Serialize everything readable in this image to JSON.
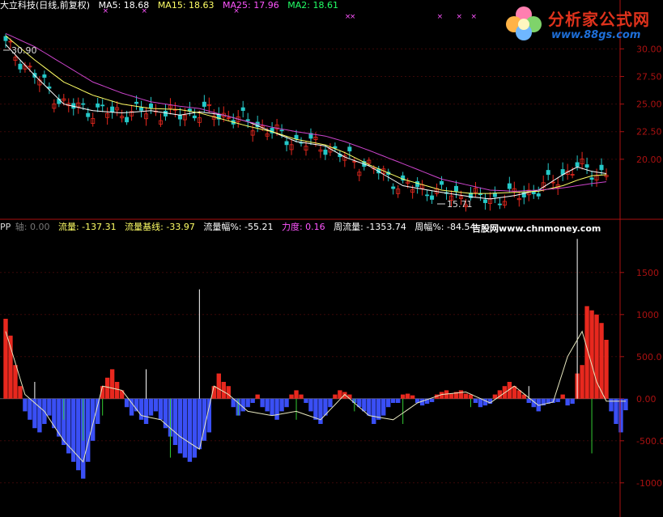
{
  "header_top": {
    "stock": "大立科技(日线,前复权)",
    "ma5": "MA5: 18.68",
    "ma15": "MA15: 18.63",
    "ma25": "MA25: 17.96",
    "ma2": "MA2: 18.61"
  },
  "header_bottom": {
    "name": "PP",
    "axis": "轴: 0.00",
    "flow": "流量: -137.31",
    "flow_base": "流量基线: -33.97",
    "flow_pct": "流量幅%: -55.21",
    "force": "力度: 0.16",
    "week_flow": "周流量: -1353.74",
    "week_pct": "周幅%: -84.54"
  },
  "watermark_bottom": "吉股网www.chnmoney.com",
  "logo": {
    "title": "分析家公式网",
    "url": "www.88gs.com"
  },
  "price_markers": {
    "high": "30.90",
    "low": "15.71"
  },
  "colors": {
    "up": "#e8281e",
    "down": "#3a4ff5",
    "ma5": "#ffffff",
    "ma15": "#ffff66",
    "ma25": "#cc44cc",
    "axis": "#aa1111",
    "teal": "#25c8c8"
  },
  "chart_data": [
    {
      "type": "line",
      "title": "大立科技(日线,前复权)",
      "ylim": [
        15,
        31.5
      ],
      "yticks": [
        "30.00",
        "27.50",
        "25.00",
        "22.50",
        "20.00"
      ],
      "yticks_num": [
        30,
        27.5,
        25,
        22.5,
        20
      ],
      "n": 125,
      "series": [
        {
          "name": "MA5",
          "keys": [
            [
              0,
              30.4
            ],
            [
              6,
              27.6
            ],
            [
              12,
              25.0
            ],
            [
              18,
              24.4
            ],
            [
              24,
              24.2
            ],
            [
              30,
              24.4
            ],
            [
              36,
              24.0
            ],
            [
              40,
              24.3
            ],
            [
              45,
              24.0
            ],
            [
              50,
              23.4
            ],
            [
              55,
              22.5
            ],
            [
              60,
              21.6
            ],
            [
              66,
              21.2
            ],
            [
              70,
              20.2
            ],
            [
              75,
              19.4
            ],
            [
              82,
              17.6
            ],
            [
              90,
              17.0
            ],
            [
              96,
              16.6
            ],
            [
              100,
              16.4
            ],
            [
              105,
              16.7
            ],
            [
              110,
              17.2
            ],
            [
              115,
              18.6
            ],
            [
              118,
              19.3
            ],
            [
              121,
              18.9
            ],
            [
              124,
              18.7
            ]
          ]
        },
        {
          "name": "MA15",
          "keys": [
            [
              0,
              31.2
            ],
            [
              6,
              29.0
            ],
            [
              12,
              27.0
            ],
            [
              18,
              25.8
            ],
            [
              24,
              25.0
            ],
            [
              30,
              24.6
            ],
            [
              36,
              24.5
            ],
            [
              40,
              24.2
            ],
            [
              45,
              23.6
            ],
            [
              50,
              23.0
            ],
            [
              55,
              22.5
            ],
            [
              60,
              21.8
            ],
            [
              66,
              21.3
            ],
            [
              70,
              20.6
            ],
            [
              75,
              19.5
            ],
            [
              82,
              18.2
            ],
            [
              90,
              17.2
            ],
            [
              96,
              16.9
            ],
            [
              100,
              16.9
            ],
            [
              105,
              17.0
            ],
            [
              110,
              17.1
            ],
            [
              115,
              17.6
            ],
            [
              118,
              18.1
            ],
            [
              121,
              18.5
            ],
            [
              124,
              18.6
            ]
          ]
        },
        {
          "name": "MA25",
          "keys": [
            [
              0,
              31.4
            ],
            [
              6,
              30.2
            ],
            [
              12,
              28.6
            ],
            [
              18,
              27.0
            ],
            [
              24,
              26.0
            ],
            [
              30,
              25.2
            ],
            [
              36,
              24.8
            ],
            [
              40,
              24.6
            ],
            [
              45,
              24.0
            ],
            [
              50,
              23.4
            ],
            [
              55,
              22.9
            ],
            [
              60,
              22.5
            ],
            [
              66,
              22.1
            ],
            [
              70,
              21.6
            ],
            [
              75,
              20.8
            ],
            [
              82,
              19.6
            ],
            [
              90,
              18.2
            ],
            [
              96,
              17.6
            ],
            [
              100,
              17.2
            ],
            [
              105,
              17.1
            ],
            [
              110,
              17.2
            ],
            [
              115,
              17.4
            ],
            [
              118,
              17.6
            ],
            [
              121,
              17.8
            ],
            [
              124,
              17.96
            ]
          ]
        }
      ]
    },
    {
      "type": "bar",
      "title": "PP",
      "ylim": [
        -1300,
        1950
      ],
      "yticks": [
        "1500",
        "1000",
        "500.0",
        "0.00",
        "-500.0",
        "-1000"
      ],
      "yticks_num": [
        1500,
        1000,
        500,
        0,
        -500,
        -1000
      ],
      "values": [
        950,
        750,
        400,
        150,
        -150,
        -250,
        -350,
        -400,
        -300,
        -200,
        -350,
        -450,
        -550,
        -650,
        -750,
        -850,
        -950,
        -750,
        -500,
        -300,
        150,
        250,
        350,
        200,
        100,
        -100,
        -200,
        -150,
        -250,
        -300,
        -200,
        -150,
        -250,
        -350,
        -450,
        -550,
        -650,
        -700,
        -750,
        -700,
        -600,
        -500,
        -400,
        150,
        300,
        200,
        150,
        -100,
        -200,
        -150,
        -100,
        -50,
        50,
        -100,
        -150,
        -200,
        -250,
        -150,
        -100,
        50,
        100,
        50,
        -50,
        -150,
        -250,
        -300,
        -200,
        -100,
        50,
        100,
        80,
        50,
        -50,
        -100,
        -150,
        -200,
        -300,
        -250,
        -200,
        -100,
        -50,
        -50,
        50,
        60,
        40,
        -50,
        -80,
        -60,
        -40,
        50,
        80,
        100,
        60,
        80,
        100,
        60,
        50,
        -50,
        -100,
        -80,
        -60,
        50,
        100,
        150,
        200,
        150,
        100,
        50,
        -50,
        -100,
        -150,
        -80,
        -60,
        -50,
        -40,
        50,
        -80,
        -60,
        300,
        400,
        1100,
        1050,
        1000,
        900,
        700,
        -150,
        -300,
        -400,
        -137
      ],
      "spikes": [
        [
          6,
          200
        ],
        [
          12,
          -250
        ],
        [
          16,
          -500
        ],
        [
          20,
          -200
        ],
        [
          29,
          350
        ],
        [
          34,
          -700
        ],
        [
          40,
          1300
        ],
        [
          48,
          -200
        ],
        [
          60,
          -250
        ],
        [
          72,
          -150
        ],
        [
          82,
          -300
        ],
        [
          96,
          -100
        ],
        [
          108,
          150
        ],
        [
          118,
          1900
        ],
        [
          121,
          -650
        ]
      ],
      "line_keys": [
        [
          0,
          800
        ],
        [
          4,
          50
        ],
        [
          8,
          -150
        ],
        [
          12,
          -500
        ],
        [
          16,
          -750
        ],
        [
          20,
          150
        ],
        [
          24,
          100
        ],
        [
          28,
          -200
        ],
        [
          32,
          -250
        ],
        [
          36,
          -450
        ],
        [
          40,
          -600
        ],
        [
          43,
          150
        ],
        [
          46,
          50
        ],
        [
          50,
          -150
        ],
        [
          55,
          -200
        ],
        [
          60,
          -150
        ],
        [
          65,
          -250
        ],
        [
          70,
          50
        ],
        [
          75,
          -200
        ],
        [
          80,
          -250
        ],
        [
          85,
          -50
        ],
        [
          90,
          50
        ],
        [
          95,
          80
        ],
        [
          100,
          -50
        ],
        [
          105,
          150
        ],
        [
          110,
          -80
        ],
        [
          113,
          -40
        ],
        [
          116,
          500
        ],
        [
          119,
          800
        ],
        [
          122,
          200
        ],
        [
          124,
          -30
        ]
      ]
    }
  ]
}
